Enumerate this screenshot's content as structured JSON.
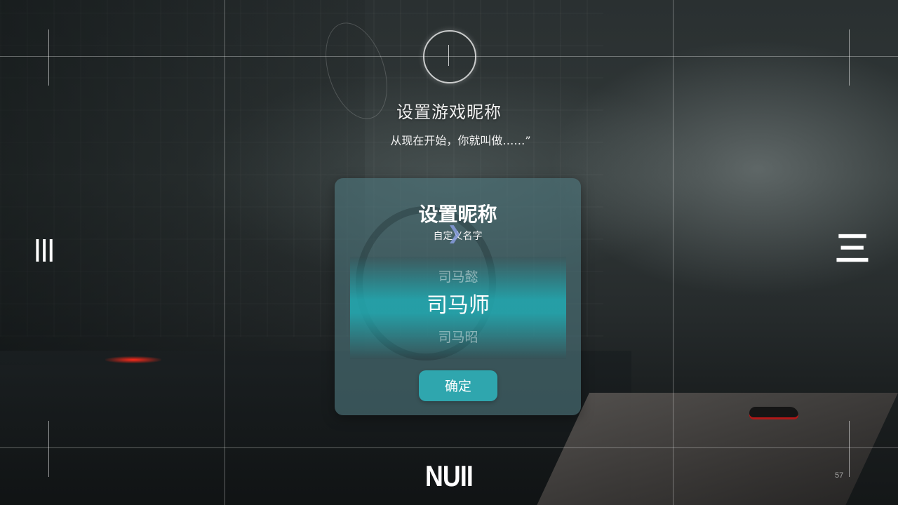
{
  "header": {
    "title": "设置游戏昵称",
    "subtitle": "从现在开始，你就叫做……”"
  },
  "dialog": {
    "title": "设置昵称",
    "subtitle": "自定义名字",
    "picker": {
      "options": [
        "司马懿",
        "司马师",
        "司马昭"
      ],
      "selected": "司马师"
    },
    "confirm_label": "确定"
  },
  "side_labels": {
    "left": "III",
    "right": "三"
  },
  "footer": {
    "logo_text": "NUII",
    "page_number": "57"
  },
  "colors": {
    "accent": "#2fa6ae",
    "panel": "#4e767c"
  }
}
